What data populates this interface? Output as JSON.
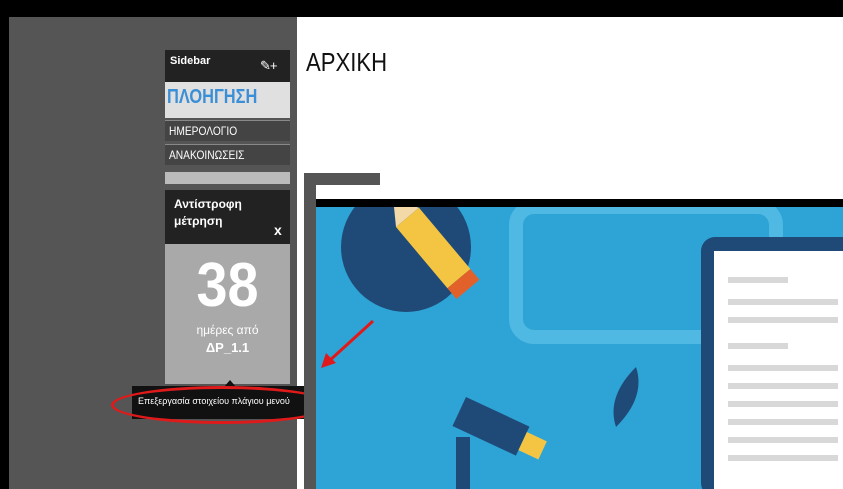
{
  "page": {
    "title": "ΑΡΧΙΚΗ"
  },
  "sidebar": {
    "header": "Sidebar",
    "edit_icon": "✎+",
    "nav_title": "ΠΛΟΗΓΗΣΗ",
    "items": [
      {
        "label": "ΗΜΕΡΟΛΟΓΙΟ"
      },
      {
        "label": "ΑΝΑΚΟΙΝΩΣΕΙΣ"
      }
    ]
  },
  "countdown": {
    "title": "Αντίστροφη μέτρηση",
    "close_label": "x",
    "number": "38",
    "days_text": "ημέρες από",
    "event_name": "ΔΡ_1.1"
  },
  "tooltip": {
    "text": "Επεξεργασία στοιχείου πλάγιου μενού"
  },
  "colors": {
    "highlight": "#e01a1a",
    "accent": "#3b8fd6",
    "image_bg": "#2ea4d6"
  }
}
